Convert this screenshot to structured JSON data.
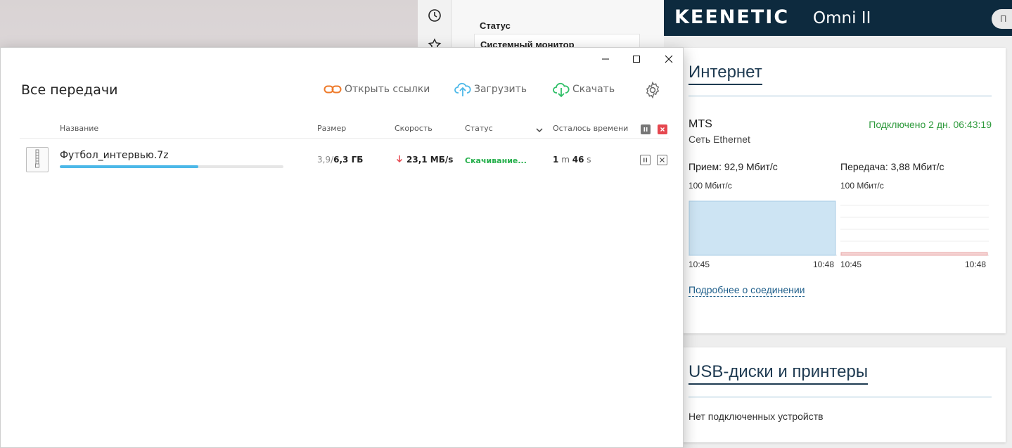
{
  "router_nav": {
    "section": "Статус",
    "item": "Системный монитор"
  },
  "router_header": {
    "brand": "KEENETIC",
    "model": "Omni II",
    "button": "П"
  },
  "internet_card": {
    "title": "Интернет",
    "provider": "MTS",
    "connection_type": "Сеть Ethernet",
    "uptime": "Подключено 2 дн. 06:43:19",
    "rx_label": "Прием: 92,9 Мбит/с",
    "tx_label": "Передача: 3,88 Мбит/с",
    "rx_scale": "100 Мбит/с",
    "tx_scale": "100 Мбит/с",
    "rx_time_start": "10:45",
    "rx_time_end": "10:48",
    "tx_time_start": "10:45",
    "tx_time_end": "10:48",
    "rx_level": 0.85,
    "tx_level": 0.04,
    "more_link": "Подробнее о соединении",
    "colors": {
      "rx": "#cde4f3",
      "tx": "#f5d3d3",
      "accent": "#2e9a3c"
    }
  },
  "usb_card": {
    "title": "USB-диски и принтеры",
    "empty_text": "Нет подключенных устройств"
  },
  "download_manager": {
    "title": "Все передачи",
    "toolbar": {
      "open_links": "Открыть ссылки",
      "upload": "Загрузить",
      "download": "Скачать"
    },
    "columns": {
      "name": "Название",
      "size": "Размер",
      "speed": "Скорость",
      "status": "Статус",
      "remaining": "Осталось времени"
    },
    "rows": [
      {
        "name": "Футбол_интервью.7z",
        "size_done": "3,9",
        "size_sep": "/",
        "size_total": "6,3  ГБ",
        "speed": "23,1 МБ/s",
        "status": "Скачивание...",
        "eta_min": "1",
        "eta_min_unit": "m",
        "eta_sec": "46",
        "eta_sec_unit": "s",
        "progress": 0.62
      }
    ]
  }
}
